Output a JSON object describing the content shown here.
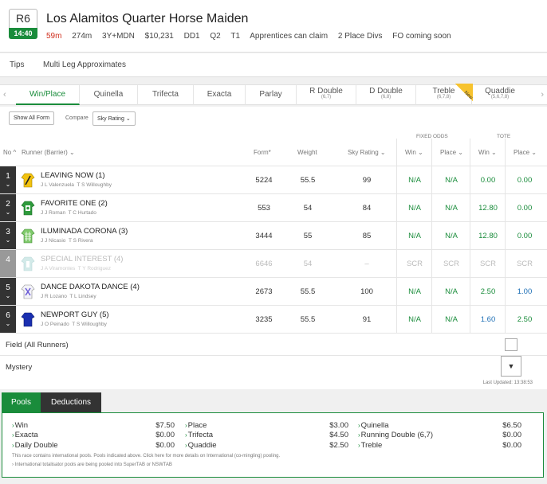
{
  "race": {
    "number": "R6",
    "time": "14:40",
    "title": "Los Alamitos Quarter Horse Maiden",
    "countdown": "59m",
    "distance": "274m",
    "class": "3Y+MDN",
    "prize": "$10,231",
    "meta": [
      "DD1",
      "Q2",
      "T1",
      "Apprentices can claim",
      "2 Place Divs",
      "FO coming soon"
    ]
  },
  "tips_bar": {
    "tips": "Tips",
    "multi_leg": "Multi Leg Approximates"
  },
  "bet_tabs": [
    {
      "label": "Win/Place",
      "sub": ""
    },
    {
      "label": "Quinella",
      "sub": ""
    },
    {
      "label": "Trifecta",
      "sub": ""
    },
    {
      "label": "Exacta",
      "sub": ""
    },
    {
      "label": "Parlay",
      "sub": ""
    },
    {
      "label": "R Double",
      "sub": "(6,7)"
    },
    {
      "label": "D Double",
      "sub": "(6,8)"
    },
    {
      "label": "Treble",
      "sub": "(6,7,8)"
    },
    {
      "label": "Quaddie",
      "sub": "(5,6,7,8)"
    }
  ],
  "new_flag": "New",
  "controls": {
    "show_all_form": "Show All Form",
    "compare_label": "Compare",
    "compare_value": "Sky Rating"
  },
  "table": {
    "group_fixed": "FIXED ODDS",
    "group_tote": "TOTE",
    "headers": {
      "no": "No",
      "runner": "Runner (Barrier)",
      "form": "Form*",
      "weight": "Weight",
      "sky": "Sky Rating",
      "fo_win": "Win",
      "fo_place": "Place",
      "tote_win": "Win",
      "tote_place": "Place"
    },
    "runners": [
      {
        "no": "1",
        "name": "LEAVING NOW (1)",
        "jockey": "J L Valenzuela",
        "trainer": "T S Willoughby",
        "form": "5224",
        "weight": "55.5",
        "sky": "99",
        "fo_win": "N/A",
        "fo_place": "N/A",
        "tote_win": "0.00",
        "tote_place": "0.00"
      },
      {
        "no": "2",
        "name": "FAVORITE ONE (2)",
        "jockey": "J J Roman",
        "trainer": "T C Hurtado",
        "form": "553",
        "weight": "54",
        "sky": "84",
        "fo_win": "N/A",
        "fo_place": "N/A",
        "tote_win": "12.80",
        "tote_place": "0.00"
      },
      {
        "no": "3",
        "name": "ILUMINADA CORONA (3)",
        "jockey": "J J Nicasio",
        "trainer": "T S Rivera",
        "form": "3444",
        "weight": "55",
        "sky": "85",
        "fo_win": "N/A",
        "fo_place": "N/A",
        "tote_win": "12.80",
        "tote_place": "0.00"
      },
      {
        "no": "4",
        "name": "SPECIAL INTEREST (4)",
        "jockey": "J A Viramontes",
        "trainer": "T Y Rodriguez",
        "form": "6646",
        "weight": "54",
        "sky": "–",
        "fo_win": "SCR",
        "fo_place": "SCR",
        "tote_win": "SCR",
        "tote_place": "SCR"
      },
      {
        "no": "5",
        "name": "DANCE DAKOTA DANCE (4)",
        "jockey": "J R Lozano",
        "trainer": "T L Lindsey",
        "form": "2673",
        "weight": "55.5",
        "sky": "100",
        "fo_win": "N/A",
        "fo_place": "N/A",
        "tote_win": "2.50",
        "tote_place": "1.00"
      },
      {
        "no": "6",
        "name": "NEWPORT GUY (5)",
        "jockey": "J O Peinado",
        "trainer": "T S Willoughby",
        "form": "3235",
        "weight": "55.5",
        "sky": "91",
        "fo_win": "N/A",
        "fo_place": "N/A",
        "tote_win": "1.60",
        "tote_place": "2.50"
      }
    ],
    "field_label": "Field (All Runners)",
    "mystery_label": "Mystery",
    "last_updated": "Last Updated: 13:38:53"
  },
  "pools": {
    "tab_pools": "Pools",
    "tab_deductions": "Deductions",
    "col1": [
      {
        "label": "Win",
        "value": "$7.50"
      },
      {
        "label": "Exacta",
        "value": "$0.00"
      },
      {
        "label": "Daily Double",
        "value": "$0.00"
      }
    ],
    "col2": [
      {
        "label": "Place",
        "value": "$3.00"
      },
      {
        "label": "Trifecta",
        "value": "$4.50"
      },
      {
        "label": "Quaddie",
        "value": "$2.50"
      }
    ],
    "col3": [
      {
        "label": "Quinella",
        "value": "$6.50"
      },
      {
        "label": "Running Double (6,7)",
        "value": "$0.00"
      },
      {
        "label": "Treble",
        "value": "$0.00"
      }
    ],
    "note1": "This race contains international pools. Pools indicated above. Click here for more details on International (co-mingling) pooling.",
    "note2": "› International totalisator pools are being pooled into SuperTAB or NSWTAB"
  },
  "colors": {
    "brand_green": "#1a8c3b",
    "odds_blue": "#1e6fb6",
    "new_flag": "#f7c32e"
  }
}
